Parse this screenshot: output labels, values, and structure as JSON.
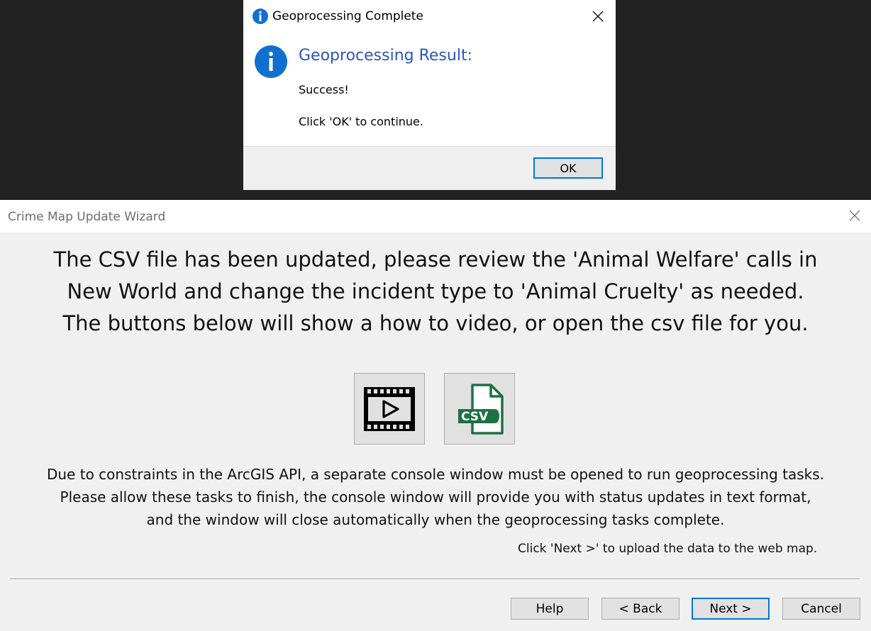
{
  "modal": {
    "title": "Geoprocessing Complete",
    "heading": "Geoprocessing Result:",
    "line1": "Success!",
    "line2": "Click 'OK' to continue.",
    "ok_label": "OK",
    "icon": "info-icon",
    "accent_color": "#0078d7"
  },
  "wizard": {
    "title": "Crime Map Update Wizard",
    "message": [
      "The CSV file has been updated, please review the 'Animal Welfare' calls in",
      "New World and change the incident type to 'Animal Cruelty' as needed.",
      "The buttons below will show a how to video, or open the csv file for you."
    ],
    "icon_buttons": [
      {
        "icon": "video-play-icon"
      },
      {
        "icon": "csv-file-icon",
        "badge": "CSV",
        "color": "#1e7145"
      }
    ],
    "note": [
      "Due to constraints in the ArcGIS API, a separate console window must be opened to run geoprocessing tasks.",
      "Please allow these tasks to finish, the console window will provide you with status updates in text format,",
      "and the window will close automatically when the geoprocessing tasks complete."
    ],
    "next_hint": "Click 'Next >' to upload the data to the web map.",
    "buttons": {
      "help": "Help",
      "back": "< Back",
      "next": "Next >",
      "cancel": "Cancel"
    }
  }
}
